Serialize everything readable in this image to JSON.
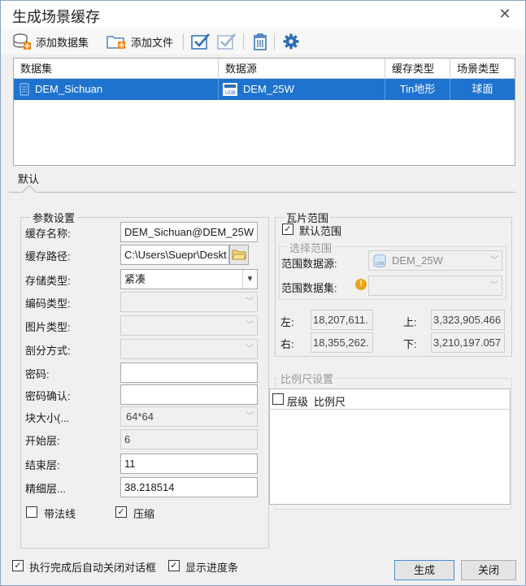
{
  "window": {
    "title": "生成场景缓存",
    "close_glyph": "✕"
  },
  "toolbar": {
    "add_dataset_label": "添加数据集",
    "add_file_label": "添加文件"
  },
  "grid": {
    "columns": [
      "数据集",
      "数据源",
      "缓存类型",
      "场景类型"
    ],
    "rows": [
      {
        "dataset": "DEM_Sichuan",
        "datasource": "DEM_25W",
        "cache_type": "Tin地形",
        "scene_type": "球面"
      }
    ]
  },
  "tab": {
    "label": "默认"
  },
  "params": {
    "group_title": "参数设置",
    "cache_name_label": "缓存名称:",
    "cache_name_value": "DEM_Sichuan@DEM_25W",
    "cache_path_label": "缓存路径:",
    "cache_path_value": "C:\\Users\\Suepr\\Deskt",
    "storage_type_label": "存储类型:",
    "storage_type_value": "紧凑",
    "encoding_type_label": "编码类型:",
    "image_type_label": "图片类型:",
    "split_mode_label": "剖分方式:",
    "password_label": "密码:",
    "password_confirm_label": "密码确认:",
    "block_size_label": "块大小(...",
    "block_size_value": "64*64",
    "start_level_label": "开始层:",
    "start_level_value": "6",
    "end_level_label": "结束层:",
    "end_level_value": "11",
    "fine_level_label": "精细层...",
    "fine_level_value": "38.218514",
    "normals_label": "带法线",
    "normals_checked": false,
    "compress_label": "压缩",
    "compress_checked": true
  },
  "tile_range": {
    "group_title": "瓦片范围",
    "default_range_label": "默认范围",
    "default_range_checked": true,
    "select_range_title": "选择范围",
    "range_datasource_label": "范围数据源:",
    "range_datasource_value": "DEM_25W",
    "range_dataset_label": "范围数据集:",
    "left_label": "左:",
    "left_value": "18,207,611.",
    "top_label": "上:",
    "top_value": "3,323,905.466",
    "right_label": "右:",
    "right_value": "18,355,262.",
    "bottom_label": "下:",
    "bottom_value": "3,210,197.057"
  },
  "scale": {
    "group_title": "比例尺设置",
    "col_level": "层级",
    "col_scale": "比例尺"
  },
  "footer": {
    "auto_close_label": "执行完成后自动关闭对话框",
    "auto_close_checked": true,
    "show_progress_label": "显示进度条",
    "show_progress_checked": true,
    "generate_label": "生成",
    "close_label": "关闭"
  },
  "colors": {
    "accent": "#1e73cf",
    "toolbar_icon": "#2d6fb6",
    "warning": "#e8a317"
  },
  "icons": [
    "database-add-icon",
    "folder-add-icon",
    "check-all-icon",
    "check-none-icon",
    "delete-icon",
    "settings-icon",
    "dataset-icon",
    "datasource-icon",
    "folder-browse-icon",
    "warning-icon"
  ]
}
